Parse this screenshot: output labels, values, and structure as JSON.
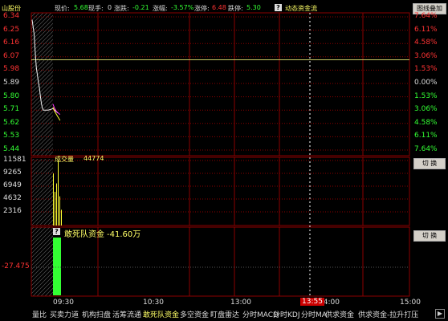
{
  "header": {
    "title": "山股份",
    "price_label": "现价:",
    "price": "5.68",
    "hand_label": "现手:",
    "hand": "0",
    "change_label": "涨跌:",
    "change": "-0.21",
    "pct_label": "涨幅:",
    "pct": "-3.57%",
    "limit_up_label": "涨停:",
    "limit_up": "6.48",
    "limit_down_label": "跌停:",
    "limit_down": "5.30",
    "flow_label": "动态资金流",
    "mode_button": "图线叠加",
    "colors": {
      "up": "#ff3333",
      "down": "#33ff33",
      "yellow": "#ffff66",
      "label": "#dddddd"
    }
  },
  "price_axis": {
    "left": [
      "6.34",
      "6.25",
      "6.16",
      "6.07",
      "5.98",
      "5.89",
      "5.80",
      "5.71",
      "5.62",
      "5.53",
      "5.44"
    ],
    "right": [
      "7.64%",
      "6.11%",
      "4.58%",
      "3.06%",
      "1.53%",
      "0.00%",
      "1.53%",
      "3.06%",
      "4.58%",
      "6.11%",
      "7.64%"
    ]
  },
  "volume_panel": {
    "title": "成交量",
    "value": "44774",
    "axis": [
      "11581",
      "9265",
      "6949",
      "4632",
      "2316"
    ],
    "switch_button": "切 换"
  },
  "fund_panel": {
    "title": "敢死队资金",
    "value": "-41.60万",
    "axis_value": "-27.475",
    "switch_button": "切 换"
  },
  "time_axis": {
    "labels": [
      "09:30",
      "10:30",
      "13:00",
      "14:00",
      "15:00"
    ],
    "cursor_time": "13:55"
  },
  "bottom_tabs": [
    "量比",
    "买卖力道",
    "机构扫盘",
    "活筹流通",
    "敢死队资金",
    "多空资金",
    "盯盘雷达",
    "分时MACD",
    "分时KDJ",
    "分时MA",
    "供求资金",
    "供求资金-拉升打压"
  ],
  "active_tab": 4,
  "chart_data": {
    "type": "line",
    "title": "",
    "ylim": [
      5.44,
      6.34
    ],
    "series": [
      {
        "values": [
          6.32,
          6.27,
          6.22,
          6.1,
          6.0,
          5.95,
          5.9,
          5.86,
          5.8,
          5.75,
          5.72,
          5.71,
          5.71,
          5.72,
          5.69
        ]
      },
      {
        "values": [
          5.75,
          5.72,
          5.7,
          5.69,
          5.68
        ]
      },
      {
        "values": [
          5.73,
          5.7,
          5.68,
          5.66,
          5.64
        ]
      }
    ],
    "volume_bars": [
      9265,
      6000,
      7500,
      11581,
      5200,
      2800
    ]
  }
}
